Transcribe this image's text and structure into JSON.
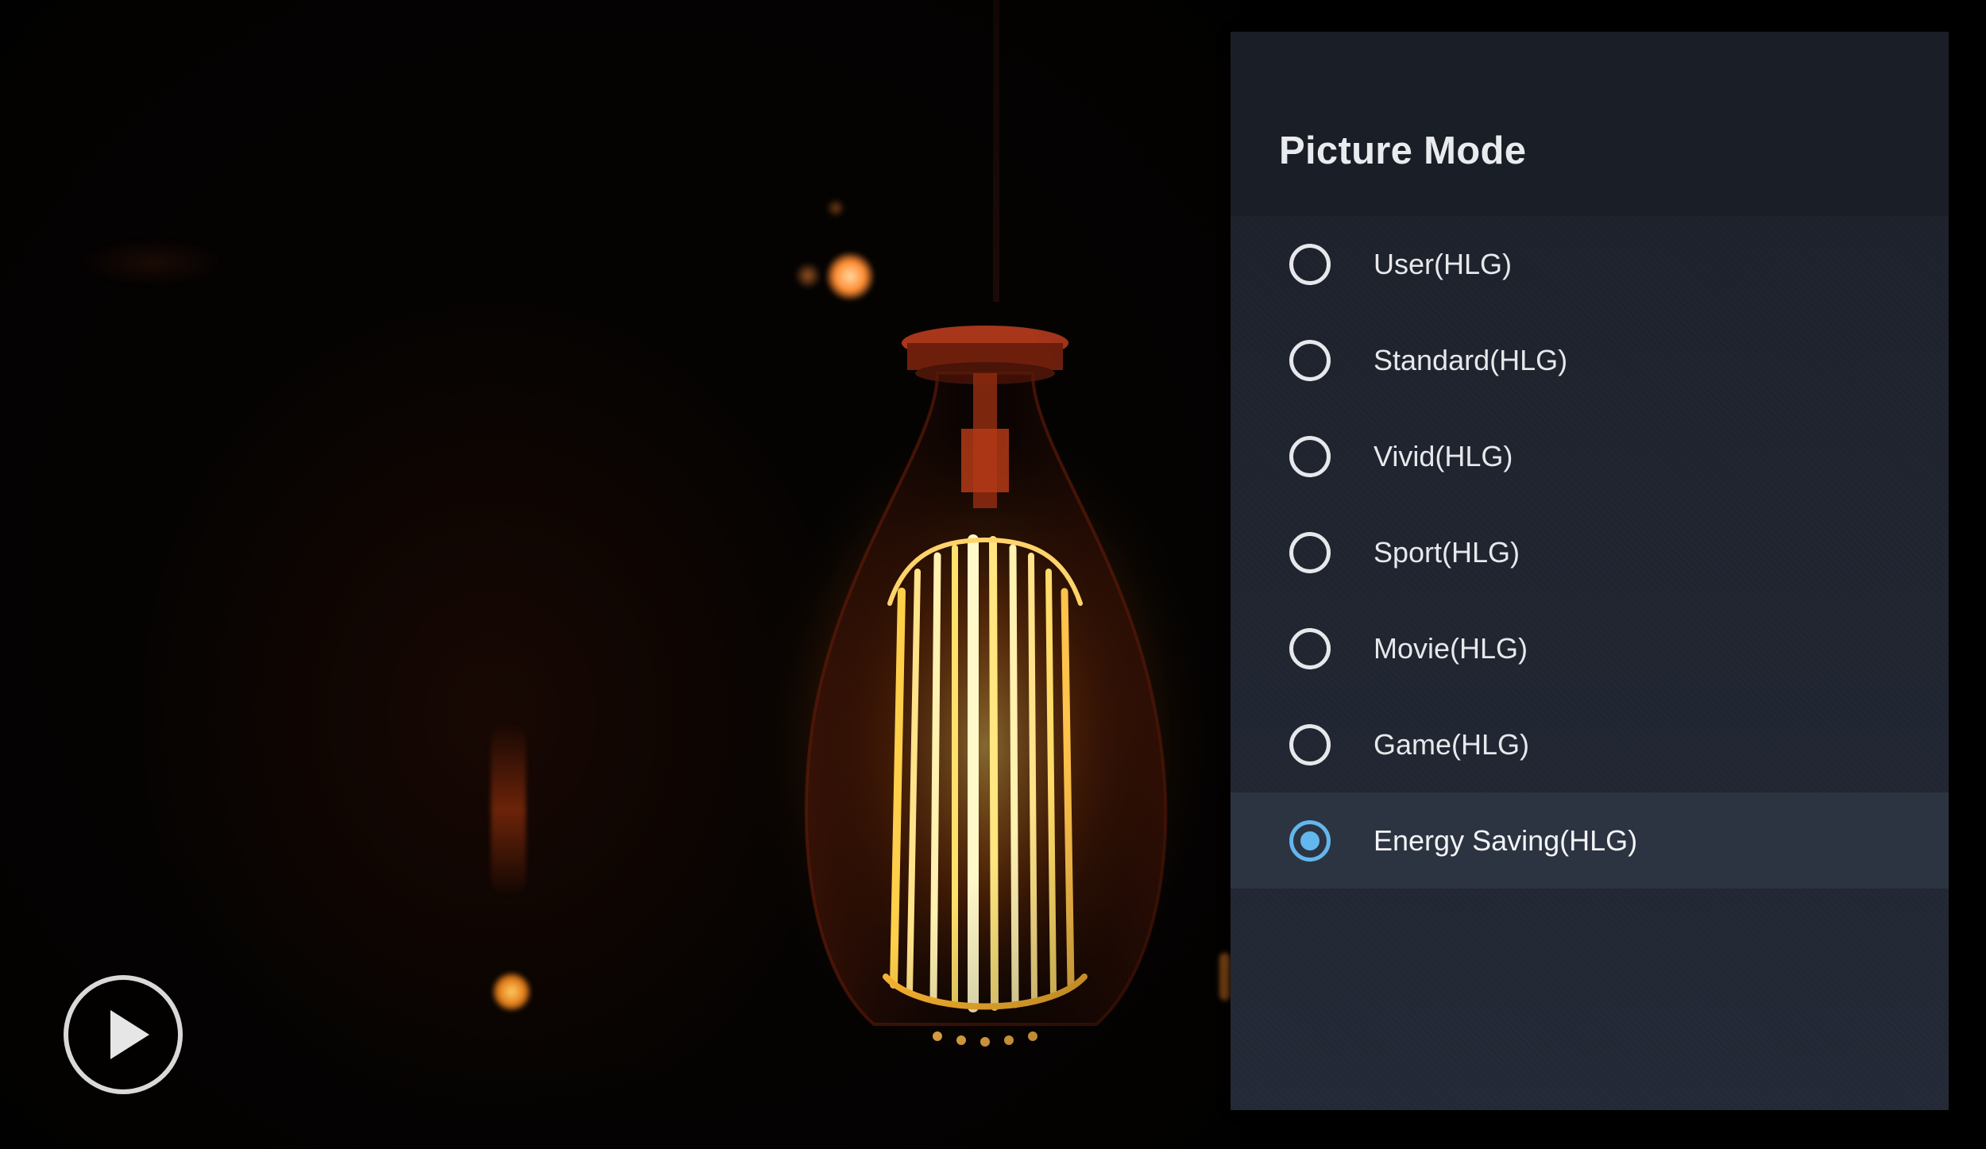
{
  "panel": {
    "title": "Picture Mode",
    "options": [
      {
        "label": "User(HLG)",
        "selected": false
      },
      {
        "label": "Standard(HLG)",
        "selected": false
      },
      {
        "label": "Vivid(HLG)",
        "selected": false
      },
      {
        "label": "Sport(HLG)",
        "selected": false
      },
      {
        "label": "Movie(HLG)",
        "selected": false
      },
      {
        "label": "Game(HLG)",
        "selected": false
      },
      {
        "label": "Energy Saving(HLG)",
        "selected": true
      }
    ]
  },
  "colors": {
    "panel_background": "#1d232d",
    "selected_row": "#2d3441",
    "radio_accent": "#62b7ee",
    "text": "#e6e8eb"
  },
  "icons": {
    "play": "play-icon",
    "radio_unchecked": "radio-unchecked-icon",
    "radio_checked": "radio-checked-icon"
  }
}
